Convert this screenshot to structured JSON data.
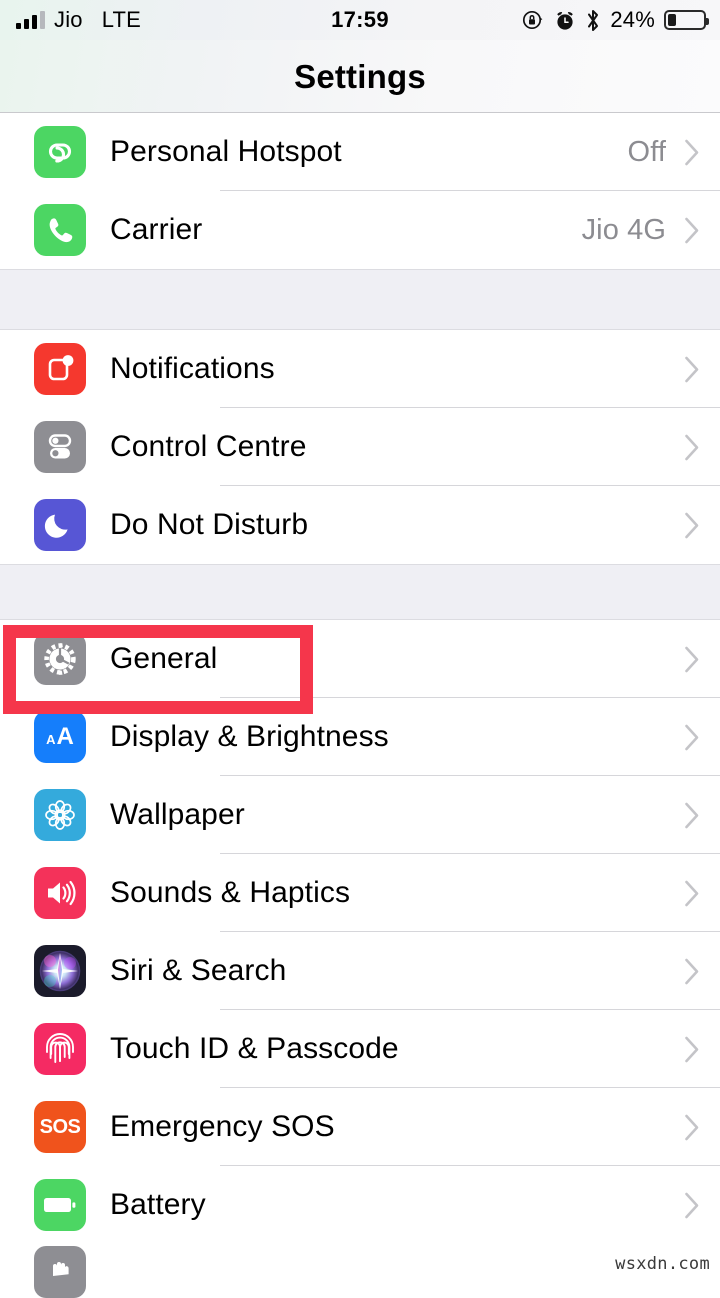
{
  "status_bar": {
    "carrier": "Jio",
    "network": "LTE",
    "time": "17:59",
    "battery_percent": "24%",
    "battery_level": 24,
    "icons": [
      "signal-bars-icon",
      "rotation-lock-icon",
      "alarm-clock-icon",
      "bluetooth-icon",
      "battery-icon"
    ]
  },
  "nav": {
    "title": "Settings"
  },
  "groups": [
    {
      "id": "connectivity",
      "rows": [
        {
          "label": "Personal Hotspot",
          "value": "Off",
          "icon": "hotspot-icon",
          "icon_class": "ic-hotspot"
        },
        {
          "label": "Carrier",
          "value": "Jio 4G",
          "icon": "phone-icon",
          "icon_class": "ic-phone"
        }
      ]
    },
    {
      "id": "alerts",
      "rows": [
        {
          "label": "Notifications",
          "value": "",
          "icon": "notifications-icon",
          "icon_class": "ic-notif"
        },
        {
          "label": "Control Centre",
          "value": "",
          "icon": "control-centre-icon",
          "icon_class": "ic-cc"
        },
        {
          "label": "Do Not Disturb",
          "value": "",
          "icon": "do-not-disturb-icon",
          "icon_class": "ic-dnd"
        }
      ]
    },
    {
      "id": "system",
      "rows": [
        {
          "label": "General",
          "value": "",
          "icon": "gear-icon",
          "icon_class": "ic-general"
        },
        {
          "label": "Display & Brightness",
          "value": "",
          "icon": "display-icon",
          "icon_class": "ic-display"
        },
        {
          "label": "Wallpaper",
          "value": "",
          "icon": "wallpaper-icon",
          "icon_class": "ic-wall"
        },
        {
          "label": "Sounds & Haptics",
          "value": "",
          "icon": "speaker-icon",
          "icon_class": "ic-sounds"
        },
        {
          "label": "Siri & Search",
          "value": "",
          "icon": "siri-icon",
          "icon_class": "ic-siri"
        },
        {
          "label": "Touch ID & Passcode",
          "value": "",
          "icon": "fingerprint-icon",
          "icon_class": "ic-touchid"
        },
        {
          "label": "Emergency SOS",
          "value": "",
          "icon": "sos-icon",
          "icon_class": "ic-sos"
        },
        {
          "label": "Battery",
          "value": "",
          "icon": "battery-icon",
          "icon_class": "ic-battery"
        }
      ]
    }
  ],
  "highlight": {
    "target_label": "General",
    "color": "#f5364b"
  },
  "watermark": {
    "text": "wsxdn.com"
  }
}
